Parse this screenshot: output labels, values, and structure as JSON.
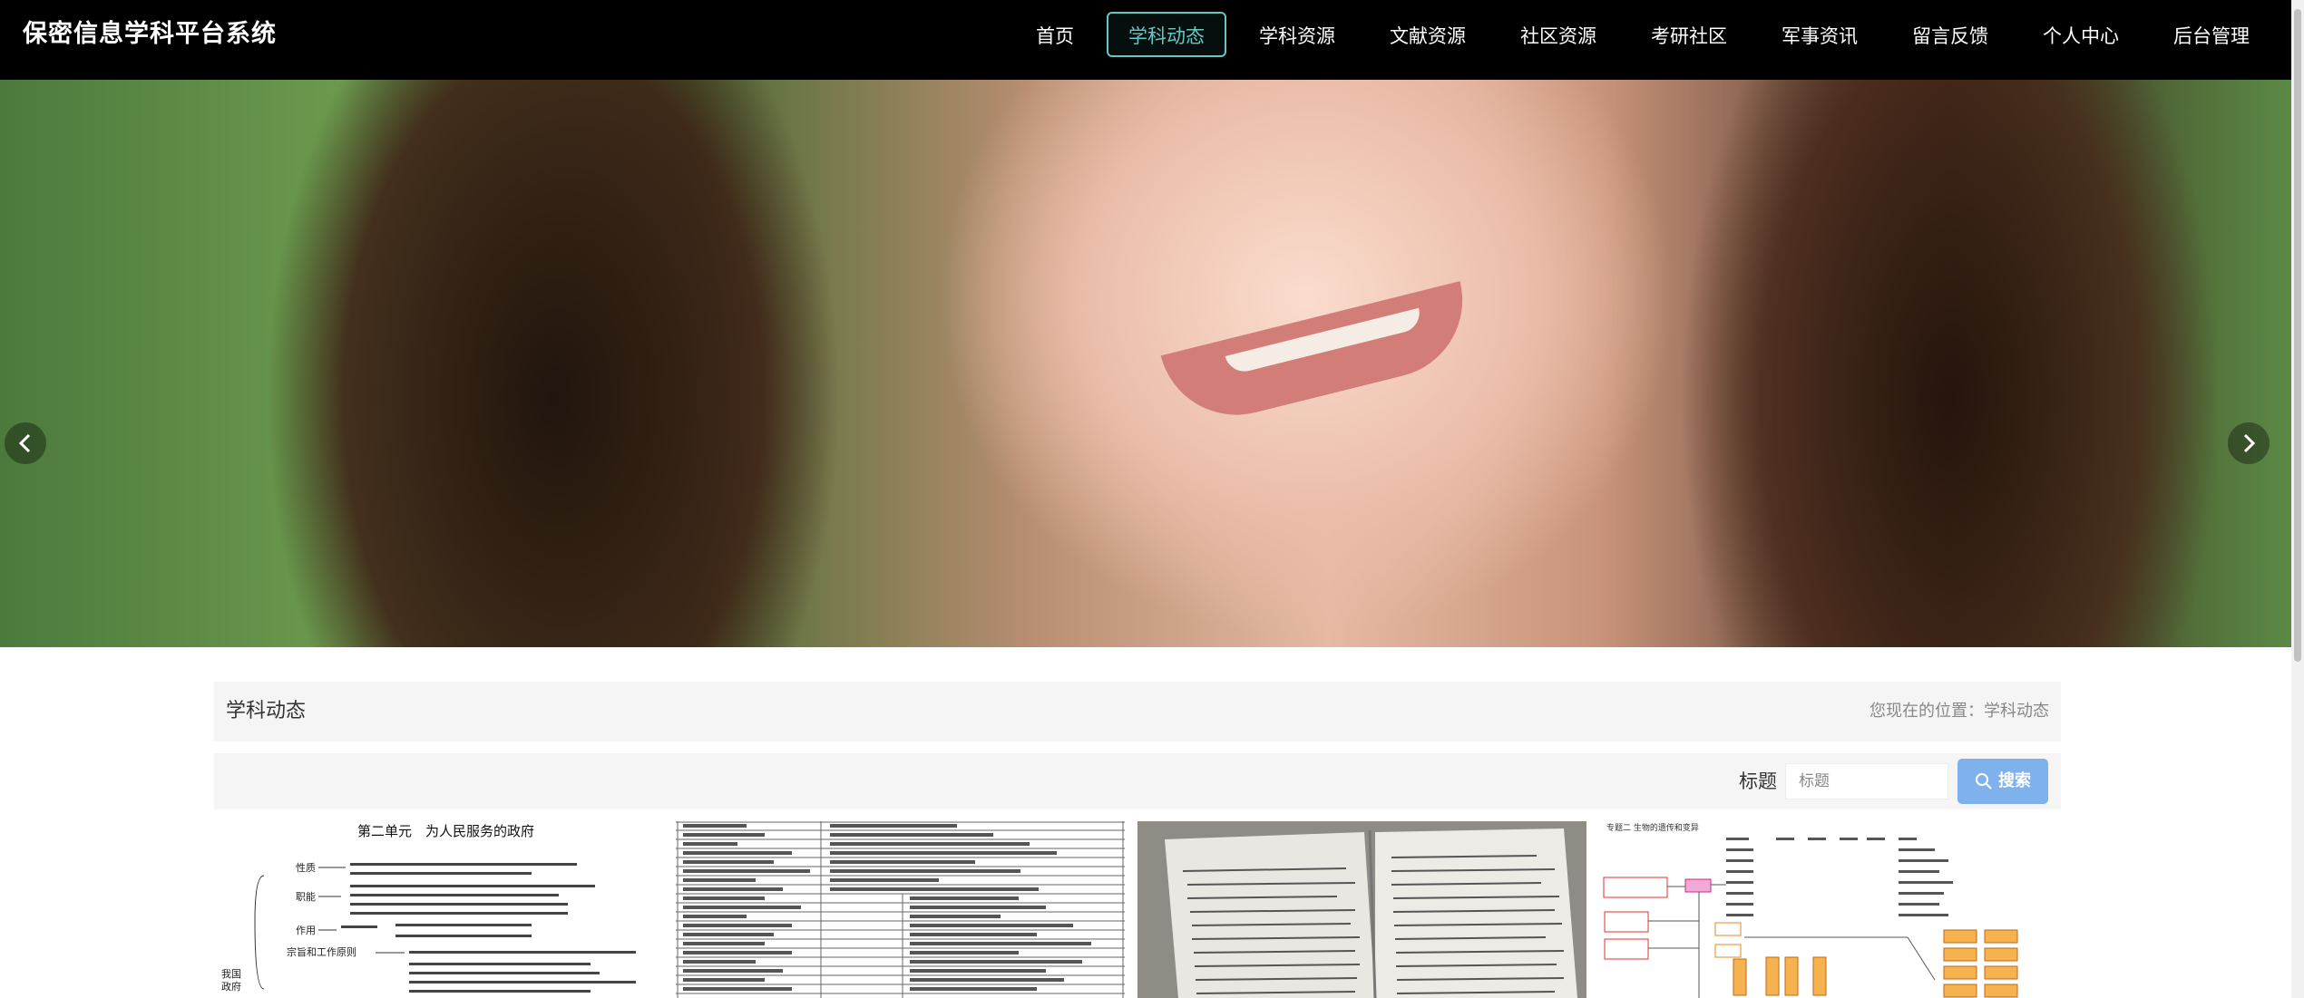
{
  "app": {
    "title": "保密信息学科平台系统"
  },
  "nav": {
    "items": [
      {
        "label": "首页",
        "active": false
      },
      {
        "label": "学科动态",
        "active": true
      },
      {
        "label": "学科资源",
        "active": false
      },
      {
        "label": "文献资源",
        "active": false
      },
      {
        "label": "社区资源",
        "active": false
      },
      {
        "label": "考研社区",
        "active": false
      },
      {
        "label": "军事资讯",
        "active": false
      },
      {
        "label": "留言反馈",
        "active": false
      },
      {
        "label": "个人中心",
        "active": false
      },
      {
        "label": "后台管理",
        "active": false
      }
    ]
  },
  "carousel": {
    "slide_count": 3,
    "active_index": 0
  },
  "section": {
    "title": "学科动态",
    "breadcrumb": "您现在的位置：学科动态"
  },
  "search": {
    "label": "标题",
    "placeholder": "标题",
    "value": "",
    "button_label": "搜索"
  },
  "cards": {
    "card1": {
      "heading": "第二单元　为人民服务的政府"
    },
    "card4": {
      "heading": "专题二 生物的遗传和变异"
    }
  },
  "colors": {
    "accent": "#64c8c2",
    "search_button": "#7fb1ec",
    "header_bg": "#000000"
  }
}
